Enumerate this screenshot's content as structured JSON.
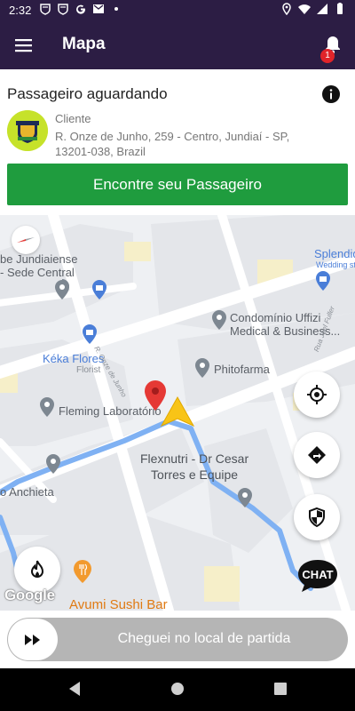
{
  "status_bar": {
    "time": "2:32",
    "notification_icons": [
      "shield-icon",
      "shield-icon",
      "google-icon",
      "mail-icon",
      "dot-icon"
    ],
    "right_icons": [
      "location-icon",
      "wifi-icon",
      "signal-icon",
      "battery-icon"
    ]
  },
  "app_bar": {
    "title": "Mapa",
    "notification_count": "1"
  },
  "ride_card": {
    "heading": "Passageiro aguardando",
    "role": "Cliente",
    "address": "R. Onze de Junho, 259 - Centro, Jundiaí - SP, 13201-038, Brazil",
    "find_button": "Encontre seu Passageiro"
  },
  "map": {
    "places": {
      "club": "be Jundiaiense\n- Sede Central",
      "splendida": "Splendida",
      "splendida_sub": "Wedding store",
      "uffizi": "Condomínio Uffizi\nMedical & Business...",
      "keka": "Kéka Flores",
      "keka_sub": "Florist",
      "phitofarma": "Phitofarma",
      "fleming": "Fleming Laboratório",
      "flexnutri": "Flexnutri - Dr Cesar\nTorres e Equipe",
      "anchieta": "o Anchieta",
      "sushi": "Avumi Sushi Bar"
    },
    "streets": {
      "onze": "R. Onze de Junho",
      "joel": "Rua Joel Fuller"
    },
    "attribution": "Google",
    "chat_label": "CHAT",
    "route_color": "#7fb1f3"
  },
  "arrival_slider": {
    "label": "Cheguei no local de partida"
  }
}
